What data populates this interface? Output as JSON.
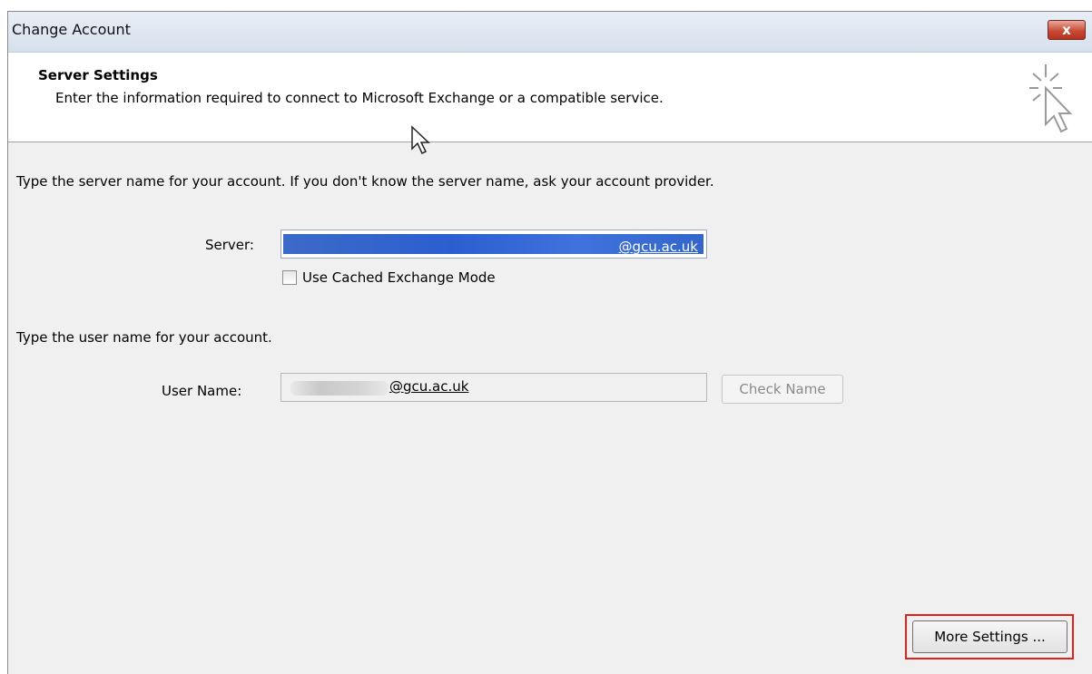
{
  "window": {
    "title": "Change Account",
    "close_label": "x"
  },
  "header": {
    "title": "Server Settings",
    "subtitle": "Enter the information required to connect to Microsoft Exchange or a compatible service."
  },
  "server": {
    "intro": "Type the server name for your account. If you don't know the server name, ask your account provider.",
    "label": "Server:",
    "value_domain": "@gcu.ac.uk",
    "cached_mode_label": "Use Cached Exchange Mode",
    "cached_mode_checked": false
  },
  "user": {
    "intro": "Type the user name for your account.",
    "label": "User Name:",
    "value_domain": "@gcu.ac.uk",
    "check_name_label": "Check Name"
  },
  "footer": {
    "more_settings_label": "More Settings ..."
  },
  "colors": {
    "highlight": "#3366cc",
    "annotation_outline": "#e1221b",
    "close_button": "#c94b36"
  }
}
